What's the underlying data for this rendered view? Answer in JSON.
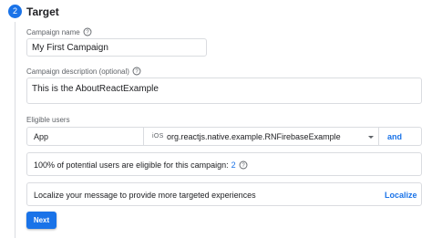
{
  "step": {
    "number": "2",
    "title": "Target"
  },
  "campaign_name": {
    "label": "Campaign name",
    "value": "My First Campaign"
  },
  "campaign_description": {
    "label": "Campaign description (optional)",
    "value": "This is the AboutReactExample"
  },
  "eligible_users": {
    "label": "Eligible users",
    "target": "App",
    "platform": "iOS",
    "app_id": "org.reactjs.native.example.RNFirebaseExample",
    "and_label": "and"
  },
  "eligibility_info": {
    "text": "100% of potential users are eligible for this campaign:",
    "count": "2"
  },
  "localize": {
    "text": "Localize your message to provide more targeted experiences",
    "link": "Localize"
  },
  "buttons": {
    "next": "Next"
  },
  "colors": {
    "accent": "#1a73e8",
    "border": "#dadce0",
    "muted_text": "#5f6368"
  },
  "icons": {
    "help": "help-circle-icon",
    "dropdown": "caret-down-icon"
  }
}
